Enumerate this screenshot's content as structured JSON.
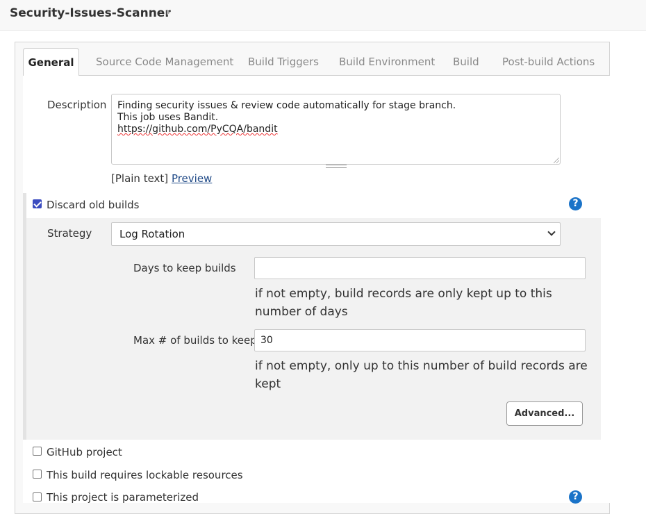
{
  "project": {
    "title": "Security-Issues-Scanner"
  },
  "tabs": [
    {
      "label": "General"
    },
    {
      "label": "Source Code Management"
    },
    {
      "label": "Build Triggers"
    },
    {
      "label": "Build Environment"
    },
    {
      "label": "Build"
    },
    {
      "label": "Post-build Actions"
    }
  ],
  "description": {
    "label": "Description",
    "lines": [
      "Finding security issues & review code automatically for stage branch.",
      "This job uses Bandit.",
      "https://github.com/PyCQA/bandit"
    ],
    "format_text": "[Plain text]",
    "preview_link": "Preview"
  },
  "discard": {
    "label": "Discard old builds",
    "checked": true,
    "strategy_label": "Strategy",
    "strategy_value": "Log Rotation",
    "days_label": "Days to keep builds",
    "days_value": "",
    "days_hint": "if not empty, build records are only kept up to this number of days",
    "max_label": "Max # of builds to keep",
    "max_value": "30",
    "max_hint": "if not empty, only up to this number of build records are kept",
    "advanced_label": "Advanced..."
  },
  "options": [
    {
      "label": "GitHub project",
      "checked": false
    },
    {
      "label": "This build requires lockable resources",
      "checked": false
    },
    {
      "label": "This project is parameterized",
      "checked": false
    }
  ],
  "help_icon": "?",
  "colors": {
    "accent": "#3b4cc0",
    "help": "#1a73c8",
    "link": "#204a87"
  }
}
